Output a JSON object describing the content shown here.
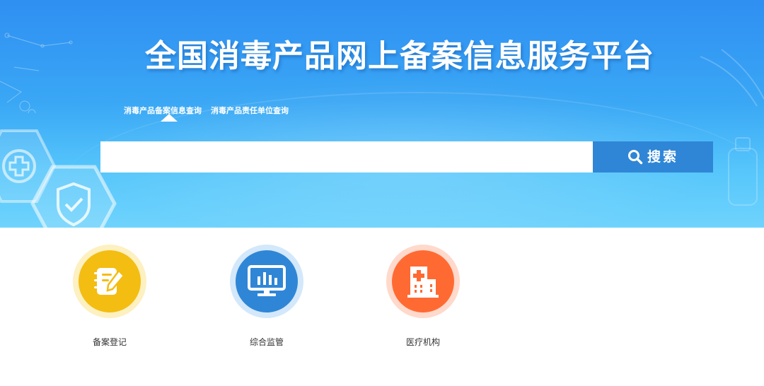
{
  "page": {
    "title": "全国消毒产品网上备案信息服务平台"
  },
  "tabs": [
    {
      "label": "消毒产品备案信息查询",
      "active": true
    },
    {
      "label": "消毒产品责任单位查询",
      "active": false
    }
  ],
  "search": {
    "value": "",
    "placeholder": "",
    "button_label": "搜索",
    "button_icon": "search-icon"
  },
  "services": [
    {
      "label": "备案登记",
      "icon": "register-notepad-icon",
      "color": "#f3bd12",
      "ring_color": "#fdf0c1"
    },
    {
      "label": "综合监管",
      "icon": "monitor-chart-icon",
      "color": "#2f86d6",
      "ring_color": "#d3e8fa"
    },
    {
      "label": "医疗机构",
      "icon": "hospital-building-icon",
      "color": "#ff6a33",
      "ring_color": "#ffd9cb"
    }
  ],
  "colors": {
    "banner_top": "#2f8ff2",
    "banner_bottom": "#6fd3fc",
    "search_button": "#2f86d6",
    "text_dark": "#333333"
  }
}
